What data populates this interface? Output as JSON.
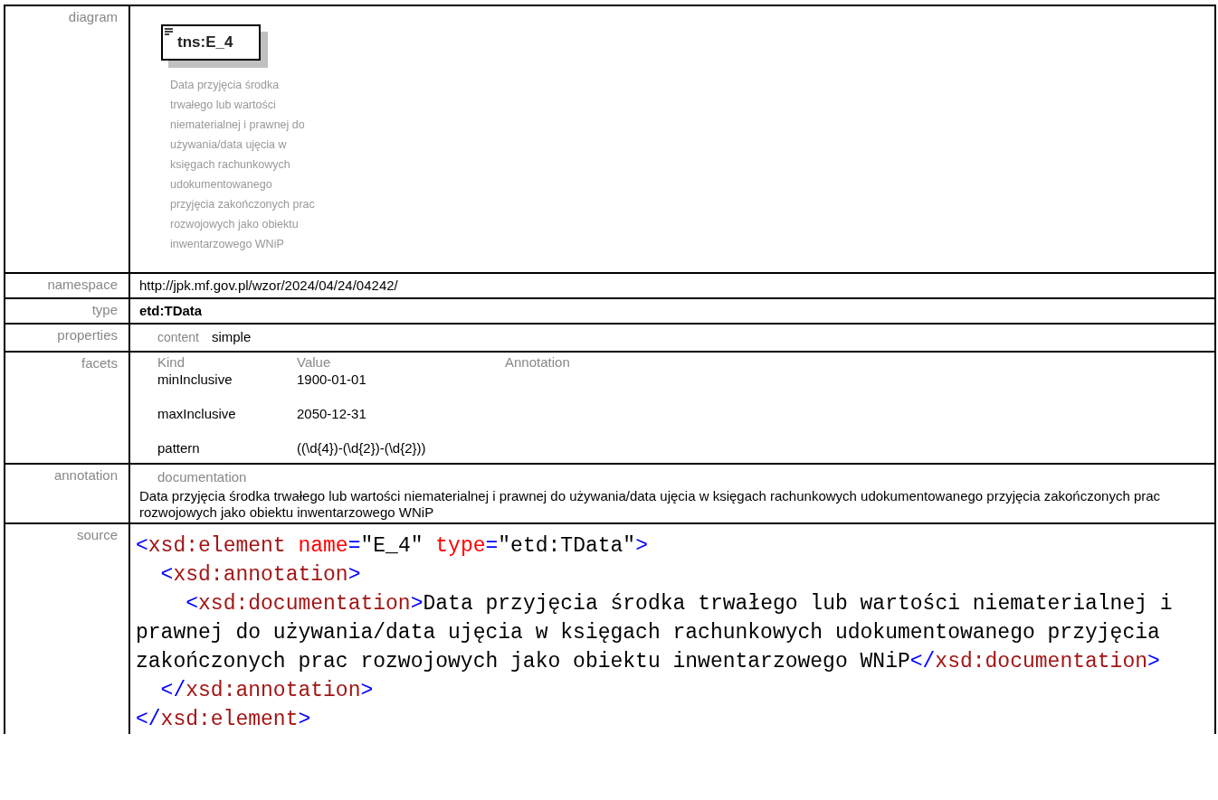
{
  "rows": [
    {
      "kind": "diagram",
      "label": "diagram",
      "element_name": "tns:E_4",
      "description_lines": [
        "Data przyjęcia środka",
        "trwałego lub wartości",
        "niematerialnej i prawnej do",
        "używania/data ujęcia w",
        "księgach rachunkowych",
        "udokumentowanego",
        "przyjęcia zakończonych prac",
        "rozwojowych jako obiektu",
        "inwentarzowego WNiP"
      ]
    },
    {
      "kind": "text",
      "label": "namespace",
      "value": "http://jpk.mf.gov.pl/wzor/2024/04/24/04242/",
      "bold": false
    },
    {
      "kind": "text",
      "label": "type",
      "value": "etd:TData",
      "bold": true
    },
    {
      "kind": "properties",
      "label": "properties",
      "items": [
        {
          "key": "content",
          "value": "simple"
        }
      ]
    },
    {
      "kind": "facets",
      "label": "facets",
      "columns": [
        "Kind",
        "Value",
        "Annotation"
      ],
      "facets": [
        {
          "kind": "minInclusive",
          "value": "1900-01-01"
        },
        {
          "kind": "maxInclusive",
          "value": "2050-12-31"
        },
        {
          "kind": "pattern",
          "value": "((\\d{4})-(\\d{2})-(\\d{2}))"
        }
      ]
    },
    {
      "kind": "annotation",
      "label": "annotation",
      "heading": "documentation",
      "text": "Data przyjęcia środka trwałego lub wartości niematerialnej i prawnej do używania/data ujęcia w księgach rachunkowych udokumentowanego przyjęcia zakończonych prac rozwojowych jako obiektu inwentarzowego WNiP"
    },
    {
      "kind": "source",
      "label": "source",
      "lines": [
        [
          {
            "kind": "punct",
            "text": "<"
          },
          {
            "kind": "tag",
            "text": "xsd:element"
          },
          {
            "kind": "attr",
            "text": " name"
          },
          {
            "kind": "punct",
            "text": "="
          },
          {
            "kind": "value",
            "text": "\"E_4\""
          },
          {
            "kind": "attr",
            "text": " type"
          },
          {
            "kind": "punct",
            "text": "="
          },
          {
            "kind": "value",
            "text": "\"etd:TData\""
          },
          {
            "kind": "punct",
            "text": ">"
          }
        ],
        [
          {
            "kind": "punct",
            "text": "  <"
          },
          {
            "kind": "tag",
            "text": "xsd:annotation"
          },
          {
            "kind": "punct",
            "text": ">"
          }
        ],
        [
          {
            "kind": "punct",
            "text": "    <"
          },
          {
            "kind": "tag",
            "text": "xsd:documentation"
          },
          {
            "kind": "punct",
            "text": ">"
          },
          {
            "kind": "plain",
            "text": "Data przyjęcia środka trwałego lub wartości niematerialnej i prawnej do używania/data ujęcia w księgach rachunkowych udokumentowanego przyjęcia zakończonych prac rozwojowych jako obiektu inwentarzowego WNiP"
          },
          {
            "kind": "punct",
            "text": "</"
          },
          {
            "kind": "tag",
            "text": "xsd:documentation"
          },
          {
            "kind": "punct",
            "text": ">"
          }
        ],
        [
          {
            "kind": "punct",
            "text": "  </"
          },
          {
            "kind": "tag",
            "text": "xsd:annotation"
          },
          {
            "kind": "punct",
            "text": ">"
          }
        ],
        [
          {
            "kind": "punct",
            "text": "</"
          },
          {
            "kind": "tag",
            "text": "xsd:element"
          },
          {
            "kind": "punct",
            "text": ">"
          }
        ]
      ]
    }
  ]
}
